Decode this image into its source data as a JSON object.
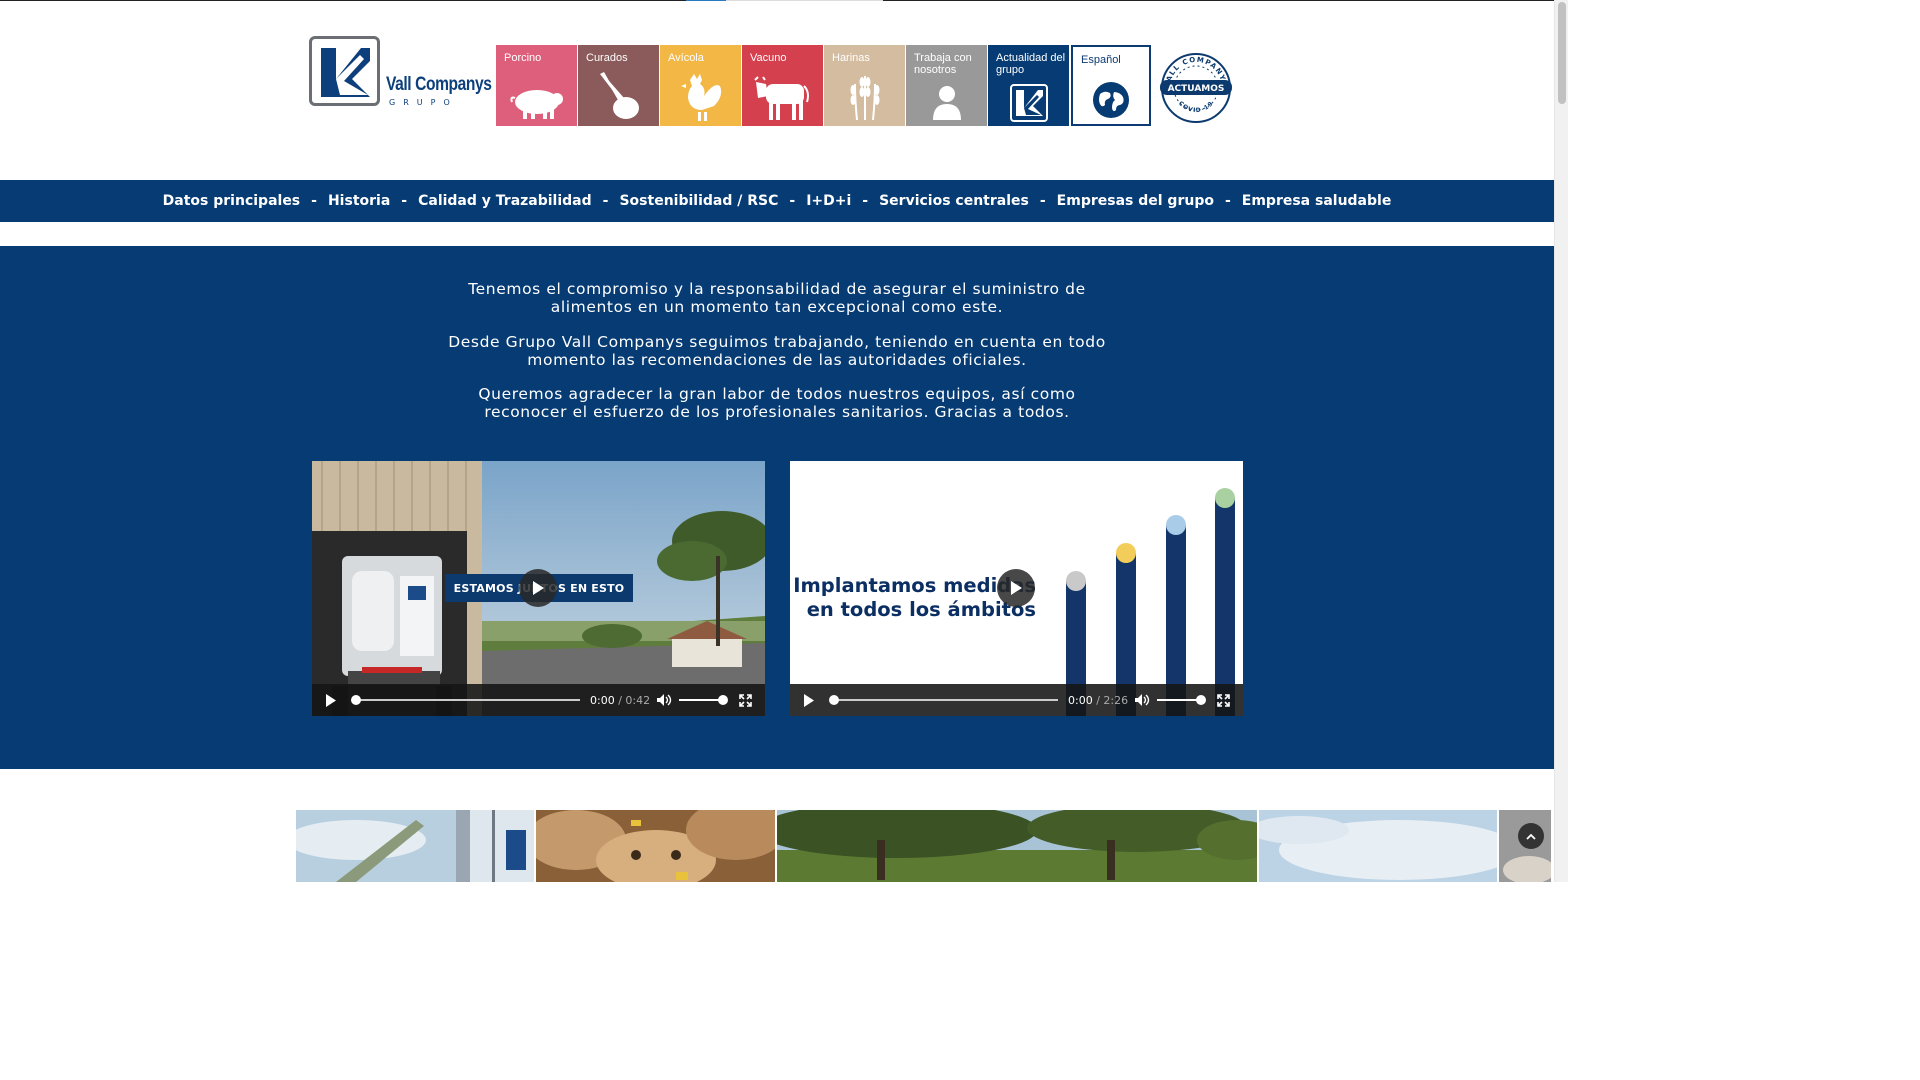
{
  "header": {
    "logo": {
      "brand": "Vall Companys",
      "subtitle": "GRUPO"
    },
    "tiles": [
      {
        "label": "Porcino",
        "icon": "pig-icon",
        "color": "#dd5f7b"
      },
      {
        "label": "Curados",
        "icon": "ham-icon",
        "color": "#8b5a5a"
      },
      {
        "label": "Avícola",
        "icon": "rooster-icon",
        "color": "#f3b746"
      },
      {
        "label": "Vacuno",
        "icon": "cow-icon",
        "color": "#d4404e"
      },
      {
        "label": "Harinas",
        "icon": "wheat-icon",
        "color": "#d3bc9f"
      },
      {
        "label": "Trabaja con nosotros",
        "icon": "person-icon",
        "color": "#999999"
      },
      {
        "label": "Actualidad del grupo",
        "icon": "vc-logo-icon",
        "color": "#063b74"
      },
      {
        "label": "Español",
        "icon": "globe-icon",
        "color": "#ffffff"
      }
    ],
    "covid_badge": {
      "top": "VALL COMPANYS",
      "middle": "ACTUAMOS",
      "bottom": "COVID-19"
    }
  },
  "nav": {
    "items": [
      "Datos principales",
      "Historia",
      "Calidad y Trazabilidad",
      "Sostenibilidad / RSC",
      "I+D+i",
      "Servicios centrales",
      "Empresas del grupo",
      "Empresa saludable"
    ],
    "separator": "-"
  },
  "hero": {
    "paragraphs": [
      "Tenemos el compromiso y la responsabilidad de asegurar el suministro de alimentos en un momento tan excepcional como este.",
      "Desde Grupo Vall Companys seguimos trabajando, teniendo en cuenta en todo momento las recomendaciones de las autoridades oficiales.",
      "Queremos agradecer la gran labor de todos nuestros equipos, así como reconocer el esfuerzo de los profesionales sanitarios. Gracias a todos."
    ]
  },
  "videos": [
    {
      "banner": "ESTAMOS JUNTOS EN ESTO",
      "time_current": "0:00",
      "time_total": "0:42",
      "progress": 0,
      "volume": 1.0
    },
    {
      "title_line1": "Implantamos medidas",
      "title_line2": "en todos los ámbitos",
      "time_current": "0:00",
      "time_total": "2:26",
      "progress": 0,
      "volume": 1.0
    }
  ],
  "time_separator": "/",
  "photos": [
    "silo-photo",
    "calves-photo",
    "dehesa-photo",
    "sky-photo",
    "partial-photo"
  ]
}
